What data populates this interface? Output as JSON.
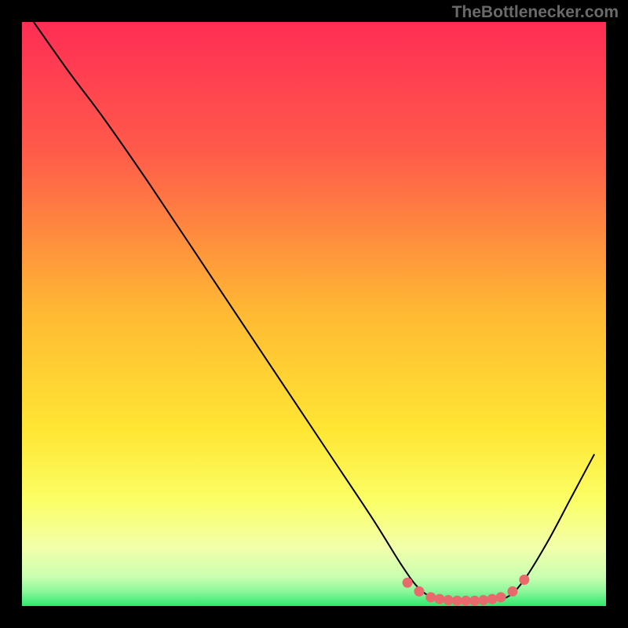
{
  "watermark": "TheBottlenecker.com",
  "colors": {
    "page_bg": "#000000",
    "curve_stroke": "#000000",
    "marker_fill": "#e96a6c",
    "watermark_color": "#6a6a6a"
  },
  "chart_data": {
    "type": "line",
    "title": "",
    "xlabel": "",
    "ylabel": "",
    "xlim": [
      0,
      100
    ],
    "ylim": [
      0,
      100
    ],
    "gradient_stops": [
      {
        "offset": 0.0,
        "color": "#ff2d55"
      },
      {
        "offset": 0.22,
        "color": "#ff5a4a"
      },
      {
        "offset": 0.5,
        "color": "#ffba33"
      },
      {
        "offset": 0.7,
        "color": "#ffe633"
      },
      {
        "offset": 0.82,
        "color": "#fbff66"
      },
      {
        "offset": 0.9,
        "color": "#f2ffab"
      },
      {
        "offset": 0.95,
        "color": "#c9ffb0"
      },
      {
        "offset": 0.975,
        "color": "#8cf79a"
      },
      {
        "offset": 1.0,
        "color": "#2ee86f"
      }
    ],
    "curve": [
      {
        "x": 2.0,
        "y": 100.0
      },
      {
        "x": 8.0,
        "y": 91.5
      },
      {
        "x": 14.0,
        "y": 83.5
      },
      {
        "x": 22.0,
        "y": 72.0
      },
      {
        "x": 32.0,
        "y": 57.0
      },
      {
        "x": 42.0,
        "y": 42.0
      },
      {
        "x": 52.0,
        "y": 27.0
      },
      {
        "x": 60.0,
        "y": 15.0
      },
      {
        "x": 65.0,
        "y": 7.0
      },
      {
        "x": 68.0,
        "y": 3.0
      },
      {
        "x": 71.0,
        "y": 1.2
      },
      {
        "x": 75.0,
        "y": 0.8
      },
      {
        "x": 79.0,
        "y": 0.9
      },
      {
        "x": 83.0,
        "y": 1.5
      },
      {
        "x": 86.0,
        "y": 4.5
      },
      {
        "x": 90.0,
        "y": 11.0
      },
      {
        "x": 94.0,
        "y": 18.5
      },
      {
        "x": 98.0,
        "y": 26.0
      }
    ],
    "markers": [
      {
        "x": 66.0,
        "y": 4.0
      },
      {
        "x": 68.0,
        "y": 2.5
      },
      {
        "x": 70.0,
        "y": 1.5
      },
      {
        "x": 71.5,
        "y": 1.2
      },
      {
        "x": 73.0,
        "y": 1.0
      },
      {
        "x": 74.5,
        "y": 0.9
      },
      {
        "x": 76.0,
        "y": 0.9
      },
      {
        "x": 77.5,
        "y": 0.9
      },
      {
        "x": 79.0,
        "y": 1.0
      },
      {
        "x": 80.5,
        "y": 1.2
      },
      {
        "x": 82.0,
        "y": 1.5
      },
      {
        "x": 84.0,
        "y": 2.5
      },
      {
        "x": 86.0,
        "y": 4.5
      }
    ]
  }
}
